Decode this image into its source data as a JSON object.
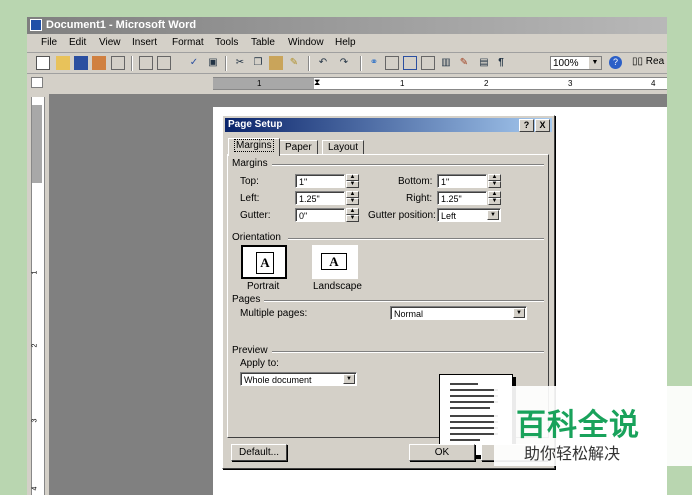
{
  "window": {
    "title": "Document1 - Microsoft Word"
  },
  "menu": [
    "File",
    "Edit",
    "View",
    "Insert",
    "Format",
    "Tools",
    "Table",
    "Window",
    "Help"
  ],
  "toolbar": {
    "zoom": "100%",
    "read_label": "Rea",
    "help_glyph": "?"
  },
  "ruler": {
    "h_numbers": [
      "1",
      "1",
      "2",
      "3",
      "4"
    ],
    "v_numbers": [
      "1",
      "2",
      "3",
      "4"
    ]
  },
  "dialog": {
    "title": "Page Setup",
    "title_buttons": {
      "help": "?",
      "close": "X"
    },
    "tabs": [
      "Margins",
      "Paper",
      "Layout"
    ],
    "margins": {
      "group_label": "Margins",
      "top_label": "Top:",
      "top_value": "1\"",
      "bottom_label": "Bottom:",
      "bottom_value": "1\"",
      "left_label": "Left:",
      "left_value": "1.25\"",
      "right_label": "Right:",
      "right_value": "1.25\"",
      "gutter_label": "Gutter:",
      "gutter_value": "0\"",
      "gutter_position_label": "Gutter position:",
      "gutter_position_value": "Left"
    },
    "orientation": {
      "group_label": "Orientation",
      "portrait": "Portrait",
      "landscape": "Landscape",
      "icon_letter": "A",
      "selected": "Portrait"
    },
    "pages": {
      "group_label": "Pages",
      "multiple_label": "Multiple pages:",
      "multiple_value": "Normal"
    },
    "preview": {
      "group_label": "Preview",
      "apply_label": "Apply to:",
      "apply_value": "Whole document"
    },
    "buttons": {
      "default": "Default...",
      "ok": "OK"
    }
  },
  "watermark": {
    "big": "百科全说",
    "small": "助你轻松解决"
  }
}
